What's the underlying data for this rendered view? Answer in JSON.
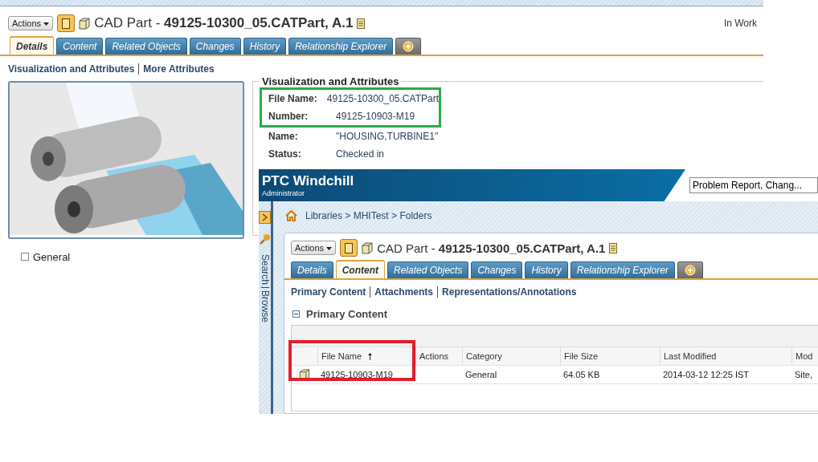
{
  "back_window": {
    "actions_label": "Actions",
    "title": "CAD Part - **49125-10300_05.CATPart, A.1**",
    "state": "In Work",
    "tabs": [
      {
        "label": "Details",
        "selected": true
      },
      {
        "label": "Content",
        "selected": false
      },
      {
        "label": "Related Objects",
        "selected": false
      },
      {
        "label": "Changes",
        "selected": false
      },
      {
        "label": "History",
        "selected": false
      },
      {
        "label": "Relationship Explorer",
        "selected": false
      }
    ],
    "links": [
      "Visualization and Attributes",
      "More Attributes"
    ],
    "section_title": "Visualization and Attributes",
    "attributes": [
      {
        "label": "File Name:",
        "value": "49125-10300_05.CATPart",
        "highlighted": true
      },
      {
        "label": "Number:",
        "value": "49125-10903-M19",
        "highlighted": true
      },
      {
        "label": "Name:",
        "value": "\"HOUSING,TURBINE1\"",
        "highlighted": false
      },
      {
        "label": "Status:",
        "value": "Checked in",
        "highlighted": false
      }
    ],
    "checkbox_item": {
      "label": "General",
      "checked": false
    }
  },
  "front_window": {
    "brand": "PTC Windchill",
    "role": "Administrator",
    "search": {
      "value": "Problem Report, Chang..."
    },
    "side_tabs": [
      "Search",
      "Browse"
    ],
    "breadcrumb": "Libraries > MHITest > Folders",
    "actions_label": "Actions",
    "title": "CAD Part - **49125-10300_05.CATPart, A.1**",
    "tabs": [
      {
        "label": "Details",
        "selected": false
      },
      {
        "label": "Content",
        "selected": true
      },
      {
        "label": "Related Objects",
        "selected": false
      },
      {
        "label": "Changes",
        "selected": false
      },
      {
        "label": "History",
        "selected": false
      },
      {
        "label": "Relationship Explorer",
        "selected": false
      }
    ],
    "links": [
      "Primary Content",
      "Attachments",
      "Representations/Annotations"
    ],
    "section": {
      "title": "Primary Content",
      "expanded": true
    },
    "table": {
      "columns": [
        {
          "label": "File Name",
          "sorted": true,
          "highlighted": true
        },
        {
          "label": "Actions",
          "sorted": false,
          "highlighted": false
        },
        {
          "label": "Category",
          "sorted": false,
          "highlighted": false
        },
        {
          "label": "File Size",
          "sorted": false,
          "highlighted": false
        },
        {
          "label": "Last Modified",
          "sorted": false,
          "highlighted": false
        },
        {
          "label": "Mod",
          "sorted": false,
          "highlighted": false
        }
      ],
      "rows": [
        {
          "file_name": "49125-10903-M19",
          "category": "General",
          "file_size": "64.05 KB",
          "last_modified": "2014-03-12 12:25 IST",
          "column_6": "Site,"
        }
      ]
    }
  }
}
